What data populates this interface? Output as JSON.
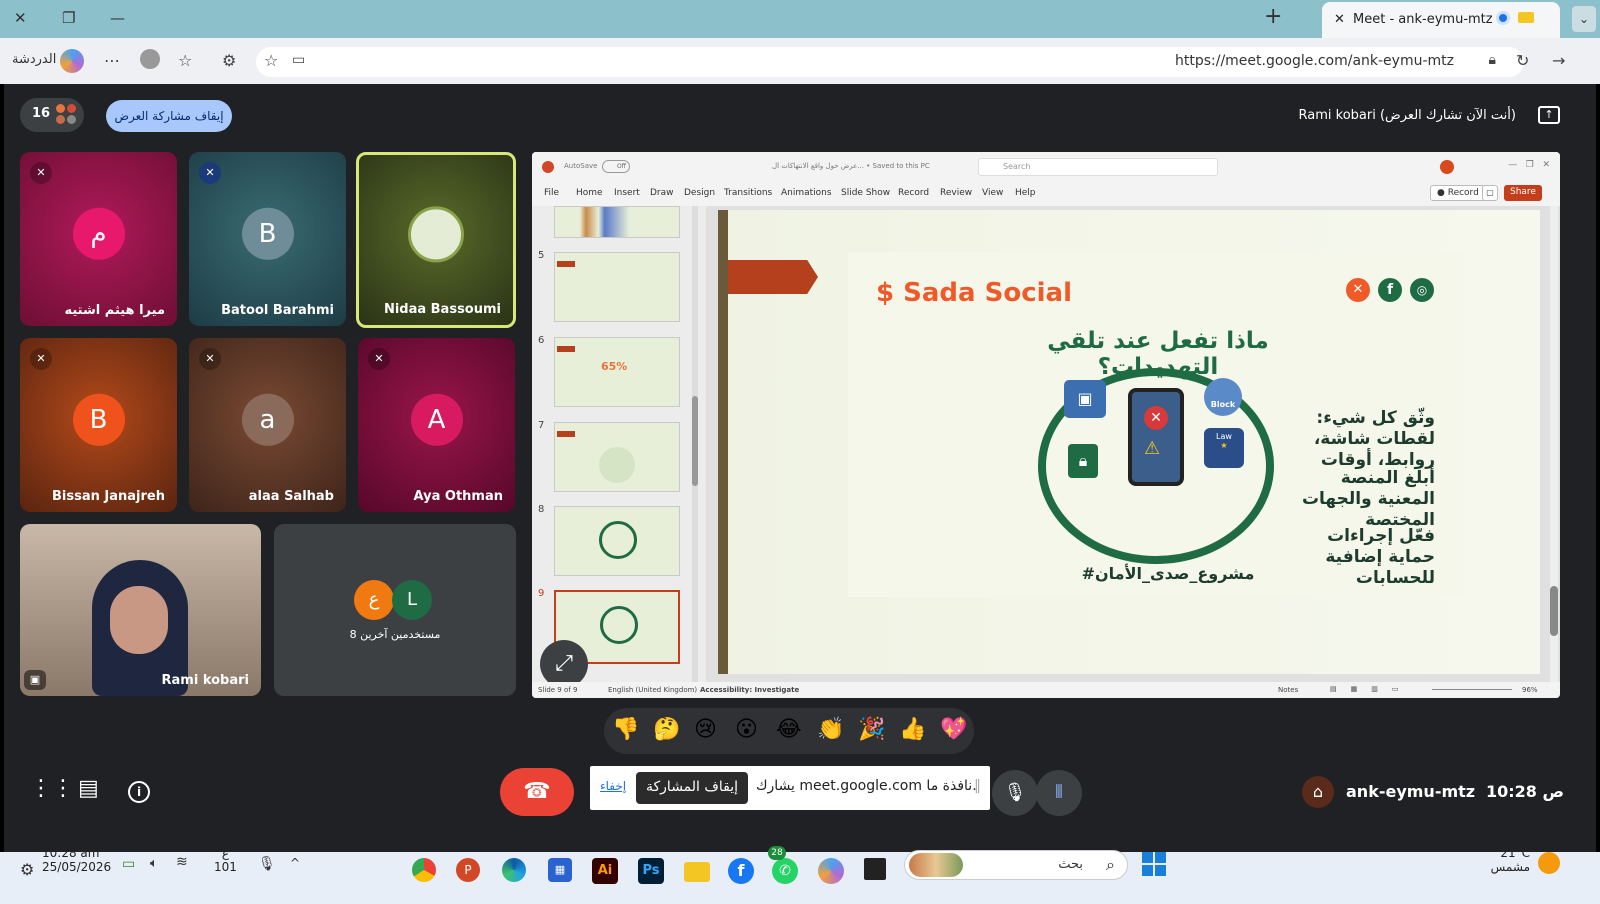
{
  "browser": {
    "tab_title": "Meet - ank-eymu-mtz",
    "url": "https://meet.google.com/ank-eymu-mtz",
    "chat_label": "الدردشة",
    "new_tab": "+",
    "more": "⋯"
  },
  "meet": {
    "participant_count": "16",
    "stop_presenting_pill": "إيقاف مشاركة العرض",
    "presenter_banner": "Rami kobari (أنت الآن تشارك العرض)",
    "meeting_code": "ank-eymu-mtz",
    "time": "10:28 ص",
    "others_label": "8 مستخدمين آخرين",
    "sharing_text": "يشارك meet.google.com نافذة ما.",
    "stop_sharing": "إيقاف المشاركة",
    "hide": "إخفاء",
    "participants": [
      {
        "name": "ميرا هيثم اشتيه",
        "initial": "م",
        "color": "#e8186d"
      },
      {
        "name": "Batool Barahmi",
        "initial": "B",
        "color": "#6f8d98"
      },
      {
        "name": "Nidaa Bassoumi",
        "initial": "",
        "color": "#6b7b3a"
      },
      {
        "name": "Bissan Janajreh",
        "initial": "B",
        "color": "#f0521b"
      },
      {
        "name": "alaa Salhab",
        "initial": "a",
        "color": "#8a6a5a"
      },
      {
        "name": "Aya Othman",
        "initial": "A",
        "color": "#d81b60"
      },
      {
        "name": "Rami kobari",
        "initial": "",
        "color": ""
      }
    ],
    "others_avatars": [
      {
        "initial": "ع",
        "color": "#f07a10"
      },
      {
        "initial": "L",
        "color": "#1e6b44"
      }
    ],
    "reactions": [
      "👎",
      "🤔",
      "😢",
      "😮",
      "😂",
      "👏",
      "🎉",
      "👍",
      "💖"
    ]
  },
  "ppt": {
    "autosave": "AutoSave",
    "off": "Off",
    "doc_title": "عرض حول واقع الانتهاكات ال... • Saved to this PC",
    "search": "Search",
    "menus": [
      "File",
      "Home",
      "Insert",
      "Draw",
      "Design",
      "Transitions",
      "Animations",
      "Slide Show",
      "Record",
      "Review",
      "View",
      "Help"
    ],
    "record": "Record",
    "share": "Share",
    "thumbs": [
      "5",
      "6",
      "7",
      "8",
      "9"
    ],
    "status_slide": "Slide 9 of 9",
    "status_lang": "English (United Kingdom)",
    "status_access": "Accessibility: Investigate",
    "status_notes": "Notes",
    "zoom": "96%"
  },
  "slide": {
    "brand": "Sada Social",
    "title": "ماذا تفعل عند تلقي التهديدات؟",
    "bullet1": "وثّق كل شيء: لقطات شاشة، روابط، أوقات",
    "bullet2": "أبلغ المنصة المعنية والجهات المختصة",
    "bullet3": "فعّل إجراءات حماية إضافية للحسابات",
    "hashtag": "#مشروع_صدى_الأمان",
    "block": "Block",
    "law": "Law"
  },
  "taskbar": {
    "time": "10:28 am",
    "date": "25/05/2026",
    "lang": "ع",
    "lang_num": "101",
    "search": "بحث",
    "weather_temp": "21°C",
    "weather_desc": "مشمس",
    "whatsapp_badge": "28"
  },
  "colors": {
    "accent_blue": "#a8c7fa",
    "end_call": "#ea4335",
    "slide_green": "#1e6b44",
    "brand_orange": "#f05a28"
  }
}
